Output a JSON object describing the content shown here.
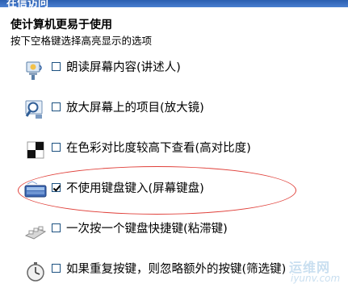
{
  "window": {
    "title": "在信访问"
  },
  "header": {
    "heading": "使计算机更易于使用",
    "subheading": "按下空格键选择高亮显示的选项"
  },
  "options": [
    {
      "label": "朗读屏幕内容(讲述人)",
      "checked": false,
      "icon": "narrator-icon"
    },
    {
      "label": "放大屏幕上的项目(放大镜)",
      "checked": false,
      "icon": "magnifier-icon"
    },
    {
      "label": "在色彩对比度较高下查看(高对比度)",
      "checked": false,
      "icon": "high-contrast-icon"
    },
    {
      "label": "不使用键盘键入(屏幕键盘)",
      "checked": true,
      "icon": "on-screen-keyboard-icon"
    },
    {
      "label": "一次按一个键盘快捷键(粘滞键)",
      "checked": false,
      "icon": "sticky-keys-icon"
    },
    {
      "label": "如果重复按键，则忽略额外的按键(筛选键)",
      "checked": false,
      "icon": "filter-keys-icon"
    }
  ],
  "watermark": {
    "line1": "运维网",
    "line2": "iyunv.com"
  },
  "colors": {
    "highlight": "#e0403a",
    "titlebar": "#2b5fb0"
  }
}
